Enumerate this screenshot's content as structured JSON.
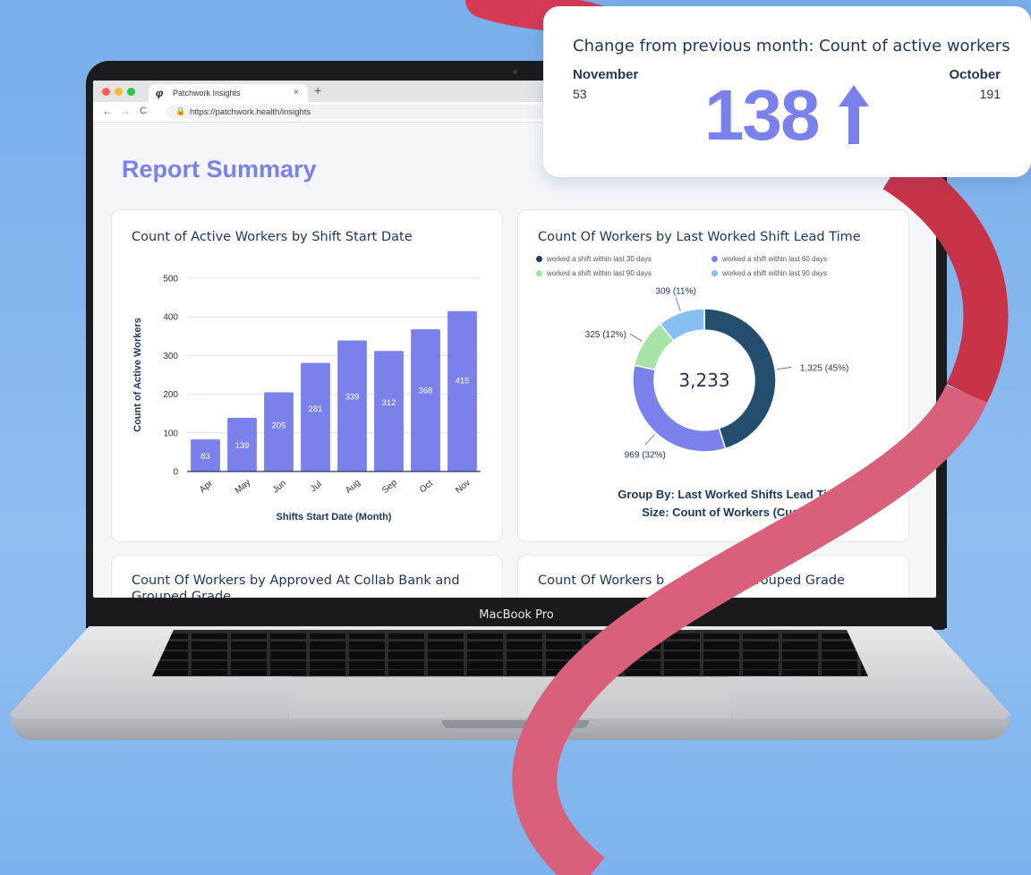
{
  "browser": {
    "tab_title": "Patchwork Insights",
    "tab_close": "×",
    "new_tab": "+",
    "url": "https://patchwork.health/insights",
    "back": "←",
    "forward": "→",
    "reload": "C"
  },
  "device": {
    "label": "MacBook Pro"
  },
  "page": {
    "title": "Report Summary"
  },
  "cards": {
    "active_workers": {
      "title": "Count of Active Workers by Shift Start Date"
    },
    "lead_time": {
      "title": "Count Of Workers by Last Worked Shift Lead Time",
      "legend": [
        {
          "label": "worked a shift within last 30 days",
          "color": "#1f3a5c"
        },
        {
          "label": "worked a shift within last 60 days",
          "color": "#7b81ea"
        },
        {
          "label": "worked a shift within last 90 days",
          "color": "#a6e3a6"
        },
        {
          "label": "worked a shift within last 90 days",
          "color": "#86bff0"
        }
      ],
      "caption_line1": "Group By: Last Worked Shifts Lead Ti",
      "caption_line2": "Size: Count of Workers (Cust"
    },
    "collab_bank": {
      "title_line1": "Count Of Workers by Approved At Collab Bank and",
      "title_line2": "Grouped Grade"
    },
    "grouped_grade": {
      "title_left": "Count Of Workers b",
      "title_right": "and Grouped Grade"
    }
  },
  "chart_data": [
    {
      "type": "bar",
      "title": "Count of Active Workers by Shift Start Date",
      "xlabel": "Shifts Start Date (Month)",
      "ylabel": "Count of Active Workers",
      "categories": [
        "Apr",
        "May",
        "Jun",
        "Jul",
        "Aug",
        "Sep",
        "Oct",
        "Nov"
      ],
      "values": [
        83,
        139,
        205,
        281,
        339,
        312,
        368,
        415
      ],
      "ylim": [
        0,
        500
      ],
      "yticks": [
        0,
        100,
        200,
        300,
        400,
        500
      ],
      "grid": true,
      "color": "#7b81ea"
    },
    {
      "type": "pie",
      "title": "Count Of Workers by Last Worked Shift Lead Time",
      "total_label": "3,233",
      "slices": [
        {
          "value": 1325,
          "label": "1,325 (45%)",
          "color": "#234e6d"
        },
        {
          "value": 969,
          "label": "969 (32%)",
          "color": "#7b81ea"
        },
        {
          "value": 325,
          "label": "325 (12%)",
          "color": "#a6e3a6"
        },
        {
          "value": 309,
          "label": "309 (11%)",
          "color": "#86bff0"
        }
      ]
    }
  ],
  "popup": {
    "title": "Change from previous month: Count of active workers",
    "current_month": "November",
    "current_value": "53",
    "previous_month": "October",
    "previous_value": "191",
    "change": "138",
    "direction_icon": "arrow-up-icon"
  }
}
